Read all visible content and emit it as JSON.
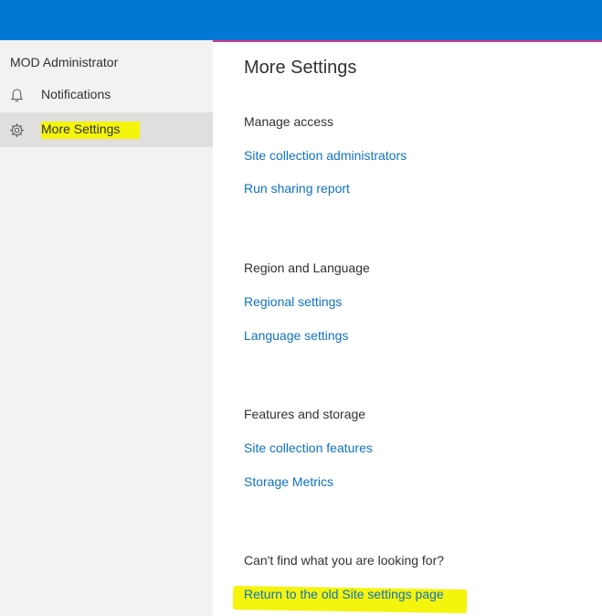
{
  "header": {
    "bar_color": "#0078d4"
  },
  "sidebar": {
    "user_name": "MOD Administrator",
    "items": [
      {
        "label": "Notifications",
        "icon": "bell-icon",
        "selected": false
      },
      {
        "label": "More Settings",
        "icon": "gear-icon",
        "selected": true,
        "highlighted": true
      }
    ]
  },
  "main": {
    "title": "More Settings",
    "sections": [
      {
        "heading": "Manage access",
        "links": [
          "Site collection administrators",
          "Run sharing report"
        ]
      },
      {
        "heading": "Region and Language",
        "links": [
          "Regional settings",
          "Language settings"
        ]
      },
      {
        "heading": "Features and storage",
        "links": [
          "Site collection features",
          "Storage Metrics"
        ]
      },
      {
        "heading": "Can't find what you are looking for?",
        "links": [
          "Return to the old Site settings page"
        ]
      }
    ]
  },
  "colors": {
    "accent": "#0078d4",
    "link": "#0f72c2",
    "highlight": "#f4f40c",
    "divider": "#d63887",
    "sidebar_bg": "#f3f2f1",
    "selected_bg": "#e1dfdd"
  }
}
